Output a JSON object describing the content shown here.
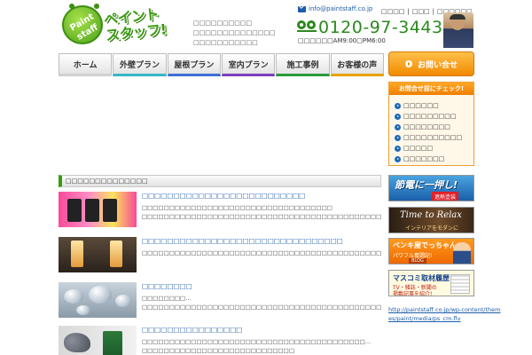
{
  "header": {
    "logo_text": "ペイント\nスタッフ!",
    "logo_badge": [
      "Paint",
      "staff"
    ],
    "tagline": [
      "□□□□□□□□□□",
      "□□□□□□□□□□□□□□",
      "□□□□□□□□□□□"
    ],
    "email": "info@paintstaff.co.jp",
    "top_links": [
      "□□□□",
      "□□□",
      "□□□□□□"
    ],
    "phone": "0120-97-3443",
    "hours": "□□□□□□AM9:00□PM6:00"
  },
  "nav": {
    "items": [
      "ホーム",
      "外壁プラン",
      "屋根プラン",
      "室内プラン",
      "施工事例",
      "お客様の声"
    ],
    "underline_colors": [
      "#d1d1d1",
      "#36b6c9",
      "#3d6fd6",
      "#7b3fbf",
      "#2a9b3a",
      "#e8a100"
    ],
    "contact_label": "お問い合せ"
  },
  "sidebar": {
    "check_title": "お問合せ前にチェック!",
    "check_items": [
      "□□□□□□",
      "□□□□□□□□□",
      "□□□□□□□□",
      "□□□□□□□□□□",
      "□□□□□",
      "□□□□□□□"
    ],
    "banners": {
      "b1_title": "節電に一押し!",
      "b1_sub": "遮熱塗装",
      "b2_title": "Time to Relax",
      "b2_sub": "インテリアをモダンに",
      "b3_title": "ペンキ屋でっちゃん",
      "b3_sub": "パワフル奮闘記!",
      "b3_badge": "BLOG",
      "b4_title": "マスコミ取材履歴",
      "b4_sub": "TV・雑誌・新聞の\n掲載記事を紹介!"
    },
    "video_link": "http://paintstaff.co.jp/wp-content/themes/paint/media/ps_cm.flv"
  },
  "main": {
    "section_title": "□□□□□□□□□□□□□□",
    "posts": [
      {
        "title": "□□□□□□□□□□□□□□□□□□□□□□□□□□",
        "body": "□□□□□□□□□□□□□□□□□□□□□□□□□□□□□□□□□□□ □□□□□□□□□□□□□□□□□□□□□□□□□□□□□□□□□□□□□□□□□□□□□□□□□□□□□□□□□□□□□□□□□□□"
      },
      {
        "title": "□□□□□□□□□□□□□□□□□□□□□□□□□□□□□□□□",
        "body": "□□□□□□□□□□□□□□□□□□□□□□□□□□□□□□□□□□□□□□□□□□□□□□□□3□5°C□□□□□□□□□□□□□□□□□□□□□□□□□□□□□□□□□□□□□□□"
      },
      {
        "title": "□□□□□□□□",
        "body": "□□□□□□□□…□□□□□□□□□□□□□□□□□□□□□□□□□□□□□□□□□□□□□□□□□□□□□□□□□□□□□□□□□□□□□□□□□□□□□□□□□□□□□□□□□□□□□□□□□□□□"
      },
      {
        "title": "□□□□□□□□□□□□□□□□",
        "body": "□□□□□□□□□□□□□□□□□□□□□□□□□□□□□□□□□□□□□□□□□…□□□□□□□□□□□□□□□□□□□□□□□□□□□□"
      }
    ]
  }
}
